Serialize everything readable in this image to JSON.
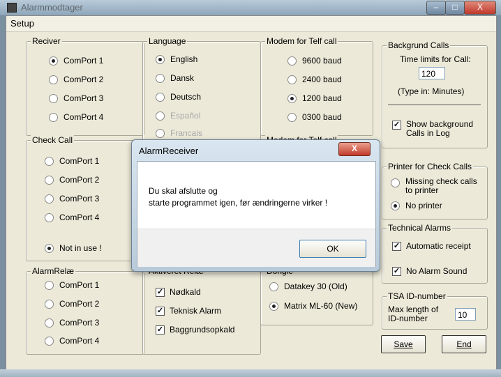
{
  "window": {
    "title": "Alarmmodtager",
    "min_label": "–",
    "max_label": "□",
    "close_label": "X"
  },
  "menu": {
    "setup": "Setup"
  },
  "receiver": {
    "legend": "Reciver",
    "options": [
      "ComPort 1",
      "ComPort 2",
      "ComPort 3",
      "ComPort 4"
    ],
    "selected": 0
  },
  "language": {
    "legend": "Language",
    "options": [
      "English",
      "Dansk",
      "Deutsch",
      "Español",
      "Francais"
    ],
    "selected": 0
  },
  "modem": {
    "legend": "Modem for Telf call",
    "options": [
      "9600 baud",
      "2400 baud",
      "1200 baud",
      "0300 baud"
    ],
    "selected": 2
  },
  "modem2": {
    "legend": "Modem for Telf call"
  },
  "background": {
    "legend": "Backgrund Calls",
    "time_label": "Time limits for Call:",
    "time_value": "120",
    "hint": "(Type in: Minutes)",
    "show_log_label_1": "Show background",
    "show_log_label_2": "Calls in Log",
    "show_log_checked": true
  },
  "check_call": {
    "legend": "Check Call",
    "options": [
      "ComPort 1",
      "ComPort 2",
      "ComPort 3",
      "ComPort 4"
    ],
    "not_in_use": "Not in use !",
    "selected": "not_in_use"
  },
  "printer": {
    "legend": "Printer for Check Calls",
    "missing_1": "Missing check calls",
    "missing_2": "to printer",
    "no_printer": "No printer",
    "selected": "no_printer"
  },
  "technical": {
    "legend": "Technical Alarms",
    "auto_receipt": "Automatic receipt",
    "no_sound": "No Alarm Sound"
  },
  "alarm_relay": {
    "legend": "AlarmRelæ",
    "options": [
      "ComPort 1",
      "ComPort 2",
      "ComPort 3",
      "ComPort 4"
    ]
  },
  "activated_relay": {
    "legend": "Aktiveret Relæ",
    "items": [
      "Nødkald",
      "Teknisk Alarm",
      "Baggrundsopkald"
    ]
  },
  "dongle": {
    "legend": "Dongle",
    "options": [
      "Datakey 30 (Old)",
      "Matrix ML-60 (New)"
    ],
    "selected": 1
  },
  "tsa": {
    "legend": "TSA ID-number",
    "label_1": "Max length of",
    "label_2": "ID-number",
    "value": "10"
  },
  "buttons": {
    "save": "Save",
    "end": "End"
  },
  "dialog": {
    "title": "AlarmReceiver",
    "close": "X",
    "message": "Du skal afslutte og\nstarte programmet igen, før ændringerne virker !",
    "ok": "OK"
  }
}
